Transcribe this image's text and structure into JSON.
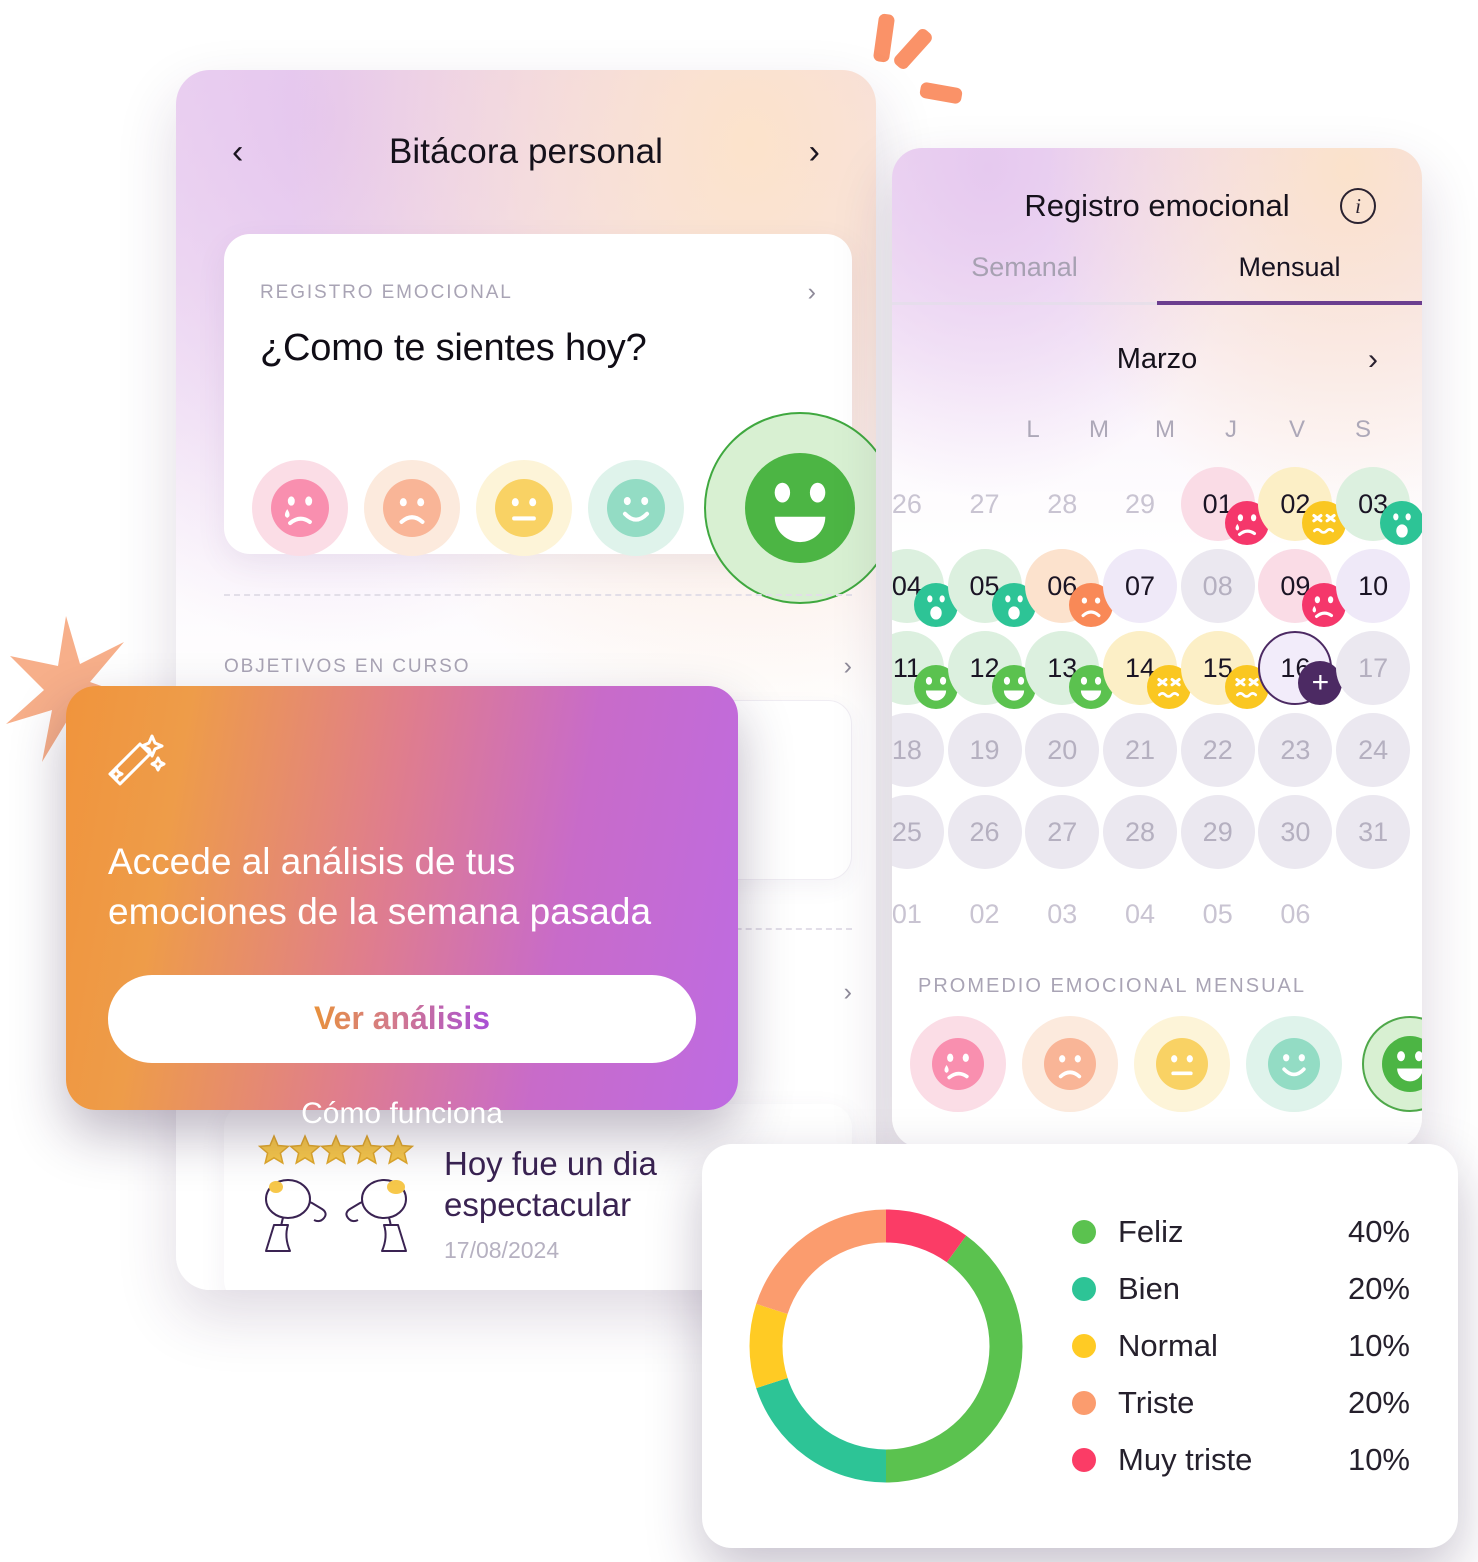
{
  "journal": {
    "title": "Bitácora personal",
    "prev_icon": "chevron-left-icon",
    "next_icon": "chevron-right-icon",
    "mood_card": {
      "eyebrow": "REGISTRO EMOCIONAL",
      "question": "¿Como te sientes hoy?",
      "moods": [
        {
          "name": "muy-triste",
          "halo": "#FBDDE6",
          "face": "#F98FAF",
          "selected": false
        },
        {
          "name": "triste",
          "halo": "#FCEADD",
          "face": "#F9B597",
          "selected": false
        },
        {
          "name": "normal",
          "halo": "#FDF4D8",
          "face": "#F9D264",
          "selected": false
        },
        {
          "name": "bien",
          "halo": "#DFF3EB",
          "face": "#93DCC4",
          "selected": false
        },
        {
          "name": "feliz",
          "halo": "#D8F0D2",
          "face": "#4CB544",
          "selected": true
        }
      ]
    },
    "goals": {
      "label": "OBJETIVOS EN CURSO",
      "chevron": "chevron-right-icon"
    },
    "entry": {
      "stars": 5,
      "title": "Hoy fue un dia espectacular",
      "date": "17/08/2024"
    }
  },
  "calendar": {
    "title": "Registro emocional",
    "info_icon": "info-icon",
    "tabs": [
      {
        "label": "Semanal",
        "active": false
      },
      {
        "label": "Mensual",
        "active": true
      }
    ],
    "month": "Marzo",
    "month_next_icon": "chevron-right-icon",
    "dow": [
      "L",
      "M",
      "M",
      "J",
      "V",
      "S"
    ],
    "days": [
      {
        "n": "26",
        "state": "muted"
      },
      {
        "n": "27",
        "state": "muted"
      },
      {
        "n": "28",
        "state": "muted"
      },
      {
        "n": "29",
        "state": "muted"
      },
      {
        "n": "01",
        "state": "muy-triste"
      },
      {
        "n": "02",
        "state": "normal"
      },
      {
        "n": "03",
        "state": "bien"
      },
      {
        "n": "04",
        "state": "bien"
      },
      {
        "n": "05",
        "state": "bien"
      },
      {
        "n": "06",
        "state": "triste"
      },
      {
        "n": "07",
        "state": "empty-purple"
      },
      {
        "n": "08",
        "state": "empty"
      },
      {
        "n": "09",
        "state": "muy-triste"
      },
      {
        "n": "10",
        "state": "empty-purple"
      },
      {
        "n": "11",
        "state": "feliz"
      },
      {
        "n": "12",
        "state": "feliz"
      },
      {
        "n": "13",
        "state": "feliz"
      },
      {
        "n": "14",
        "state": "normal"
      },
      {
        "n": "15",
        "state": "normal"
      },
      {
        "n": "16",
        "state": "today"
      },
      {
        "n": "17",
        "state": "empty"
      },
      {
        "n": "18",
        "state": "empty"
      },
      {
        "n": "19",
        "state": "empty"
      },
      {
        "n": "20",
        "state": "empty"
      },
      {
        "n": "21",
        "state": "empty"
      },
      {
        "n": "22",
        "state": "empty"
      },
      {
        "n": "23",
        "state": "empty"
      },
      {
        "n": "24",
        "state": "empty"
      },
      {
        "n": "25",
        "state": "empty"
      },
      {
        "n": "26",
        "state": "empty"
      },
      {
        "n": "27",
        "state": "empty"
      },
      {
        "n": "28",
        "state": "empty"
      },
      {
        "n": "29",
        "state": "empty"
      },
      {
        "n": "30",
        "state": "empty"
      },
      {
        "n": "31",
        "state": "empty"
      },
      {
        "n": "01",
        "state": "muted"
      },
      {
        "n": "02",
        "state": "muted"
      },
      {
        "n": "03",
        "state": "muted"
      },
      {
        "n": "04",
        "state": "muted"
      },
      {
        "n": "05",
        "state": "muted"
      },
      {
        "n": "06",
        "state": "muted"
      }
    ],
    "average_label": "PROMEDIO EMOCIONAL MENSUAL",
    "average_moods": [
      {
        "name": "muy-triste",
        "halo": "#FBDDE6",
        "face": "#F98FAF",
        "selected": false
      },
      {
        "name": "triste",
        "halo": "#FCEADD",
        "face": "#F9B597",
        "selected": false
      },
      {
        "name": "normal",
        "halo": "#FDF4D8",
        "face": "#F9D264",
        "selected": false
      },
      {
        "name": "bien",
        "halo": "#DFF3EB",
        "face": "#93DCC4",
        "selected": false
      },
      {
        "name": "feliz",
        "halo": "#D8F0D2",
        "face": "#4CB544",
        "selected": true
      }
    ]
  },
  "promo": {
    "icon": "magic-wand-icon",
    "headline": "Accede al análisis de tus emociones de la semana pasada",
    "cta_label": "Ver análisis",
    "link_label": "Cómo funciona"
  },
  "chart_data": {
    "type": "pie",
    "title": "",
    "legend_position": "right",
    "categories": [
      "Feliz",
      "Bien",
      "Normal",
      "Triste",
      "Muy triste"
    ],
    "values": [
      40,
      20,
      10,
      20,
      10
    ],
    "value_labels": [
      "40%",
      "20%",
      "10%",
      "20%",
      "10%"
    ],
    "colors": [
      "#5BC24F",
      "#2DC496",
      "#FFCB24",
      "#FB9C6E",
      "#FB3C66"
    ],
    "donut": true,
    "start_angle_deg": 36
  },
  "colors": {
    "accent_purple": "#6B3E8F",
    "badge_purple": "#4C2A63",
    "confetti_orange": "#FA9268",
    "bg": "#FFFFFF"
  }
}
